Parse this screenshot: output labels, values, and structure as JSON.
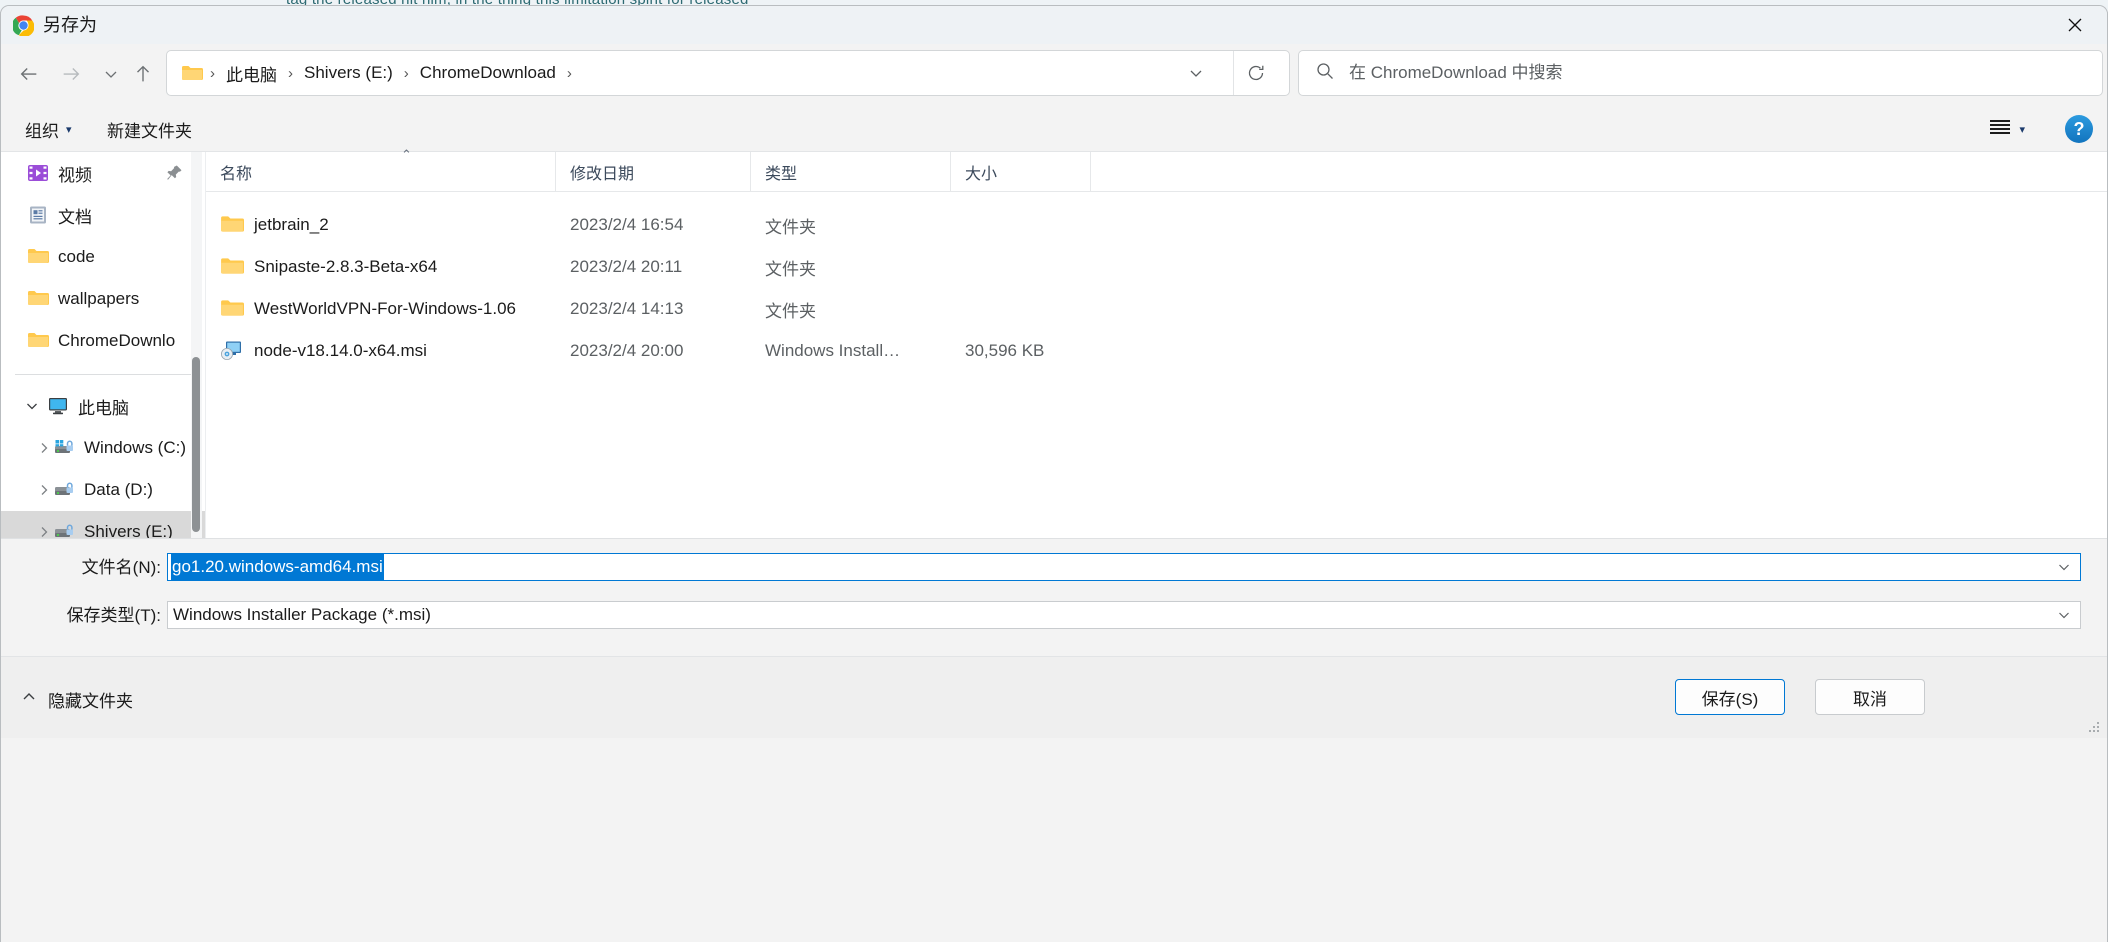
{
  "backdrop": {
    "page_text_sliver": "tag the released hit him, in the thing this limitation spirit for released"
  },
  "titlebar": {
    "app_icon": "chrome-icon",
    "title": "另存为",
    "close_label": "×"
  },
  "navbar": {
    "back_icon": "arrow-left-icon",
    "forward_icon": "arrow-right-icon",
    "recent_icon": "chevron-down-icon",
    "up_icon": "arrow-up-icon",
    "breadcrumb": {
      "folder_icon": "folder-icon",
      "items": [
        "此电脑",
        "Shivers (E:)",
        "ChromeDownload"
      ],
      "separator": "›"
    },
    "address_chevron_icon": "chevron-down-icon",
    "refresh_icon": "refresh-icon",
    "search": {
      "icon": "search-icon",
      "placeholder": "在 ChromeDownload 中搜索",
      "value": ""
    }
  },
  "toolbar": {
    "organize_label": "组织",
    "organize_caret": "▾",
    "new_folder_label": "新建文件夹",
    "view_icon": "list-view-icon",
    "view_caret": "▾",
    "help_label": "?"
  },
  "navpane": {
    "quick_access": [
      {
        "label": "视频",
        "icon": "video-folder-icon",
        "pinned": true,
        "pin_icon": "pin-icon"
      },
      {
        "label": "文档",
        "icon": "documents-folder-icon",
        "pinned": false
      },
      {
        "label": "code",
        "icon": "folder-icon",
        "pinned": false
      },
      {
        "label": "wallpapers",
        "icon": "folder-icon",
        "pinned": false
      },
      {
        "label": "ChromeDownlo",
        "icon": "folder-icon",
        "pinned": false
      }
    ],
    "this_pc": {
      "label": "此电脑",
      "icon": "monitor-icon",
      "twisty": "chevron-down-icon",
      "expanded": true,
      "drives": [
        {
          "label": "Windows (C:)",
          "icon": "drive-windows-icon",
          "twisty": "chevron-right-icon",
          "selected": false
        },
        {
          "label": "Data (D:)",
          "icon": "drive-icon",
          "twisty": "chevron-right-icon",
          "selected": false
        },
        {
          "label": "Shivers (E:)",
          "icon": "drive-icon",
          "twisty": "chevron-right-icon",
          "selected": true
        }
      ]
    }
  },
  "filelist": {
    "columns": [
      {
        "label": "名称",
        "sorted": "asc",
        "sort_caret": "⌃"
      },
      {
        "label": "修改日期"
      },
      {
        "label": "类型"
      },
      {
        "label": "大小"
      }
    ],
    "rows": [
      {
        "icon": "folder-icon",
        "name": "jetbrain_2",
        "date": "2023/2/4 16:54",
        "type": "文件夹",
        "size": ""
      },
      {
        "icon": "folder-icon",
        "name": "Snipaste-2.8.3-Beta-x64",
        "date": "2023/2/4 20:11",
        "type": "文件夹",
        "size": ""
      },
      {
        "icon": "folder-icon",
        "name": "WestWorldVPN-For-Windows-1.06",
        "date": "2023/2/4 14:13",
        "type": "文件夹",
        "size": ""
      },
      {
        "icon": "msi-installer-icon",
        "name": "node-v18.14.0-x64.msi",
        "date": "2023/2/4 20:00",
        "type": "Windows Install…",
        "size": "30,596 KB"
      }
    ]
  },
  "form": {
    "filename_label": "文件名(N):",
    "filename_value": "go1.20.windows-amd64.msi",
    "filename_selected": true,
    "savetype_label": "保存类型(T):",
    "savetype_value": "Windows Installer Package (*.msi)",
    "combo_arrow_icon": "chevron-down-icon"
  },
  "footer": {
    "hide_folders_label": "隐藏文件夹",
    "hide_folders_icon": "chevron-up-icon",
    "save_label": "保存(S)",
    "cancel_label": "取消",
    "resize_grip_icon": "resize-grip-icon"
  },
  "colors": {
    "accent": "#0078d4",
    "selection": "#0078d4",
    "folder_yellow": "#ffc94d",
    "help_blue": "#1274be",
    "selected_row": "#d9d9d9"
  }
}
